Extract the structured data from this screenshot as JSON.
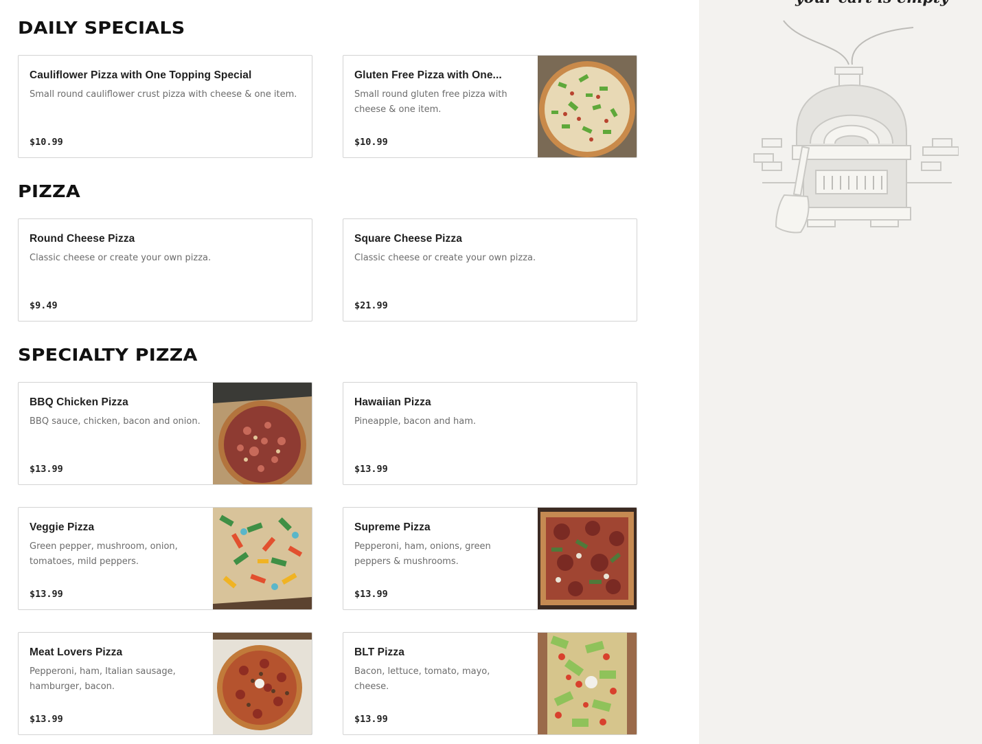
{
  "sections": [
    {
      "title": "DAILY SPECIALS",
      "items": [
        {
          "name": "Cauliflower Pizza with One Topping Special",
          "description": "Small round cauliflower crust pizza with cheese & one item.",
          "price": "$10.99",
          "image": "none"
        },
        {
          "name": "Gluten Free Pizza with One...",
          "description": "Small round gluten free pizza with cheese & one item.",
          "price": "$10.99",
          "image": "green-pepper-round-pizza"
        }
      ]
    },
    {
      "title": "PIZZA",
      "items": [
        {
          "name": "Round Cheese Pizza",
          "description": "Classic cheese or create your own pizza.",
          "price": "$9.49",
          "image": "none"
        },
        {
          "name": "Square Cheese Pizza",
          "description": "Classic cheese or create your own pizza.",
          "price": "$21.99",
          "image": "none"
        }
      ]
    },
    {
      "title": "SPECIALTY PIZZA",
      "items": [
        {
          "name": "BBQ Chicken Pizza",
          "description": "BBQ sauce, chicken, bacon and onion.",
          "price": "$13.99",
          "image": "bbq-pizza-in-box"
        },
        {
          "name": "Hawaiian Pizza",
          "description": "Pineapple, bacon and ham.",
          "price": "$13.99",
          "image": "none"
        },
        {
          "name": "Veggie Pizza",
          "description": "Green pepper, mushroom, onion, tomatoes, mild peppers.",
          "price": "$13.99",
          "image": "veggie-pizza"
        },
        {
          "name": "Supreme Pizza",
          "description": "Pepperoni, ham, onions, green peppers & mushrooms.",
          "price": "$13.99",
          "image": "supreme-square-pizza"
        },
        {
          "name": "Meat Lovers Pizza",
          "description": "Pepperoni, ham, Italian sausage, hamburger, bacon.",
          "price": "$13.99",
          "image": "meat-pizza-in-box"
        },
        {
          "name": "BLT Pizza",
          "description": "Bacon, lettuce, tomato, mayo, cheese.",
          "price": "$13.99",
          "image": "blt-square-pizza"
        }
      ]
    }
  ],
  "cart": {
    "empty_text": "your cart is empty",
    "illustration": "pizza-oven-icon"
  },
  "colors": {
    "cart_panel_bg": "#f3f2ef",
    "card_border": "#d3d3d3",
    "description_text": "#6b6b6b"
  }
}
